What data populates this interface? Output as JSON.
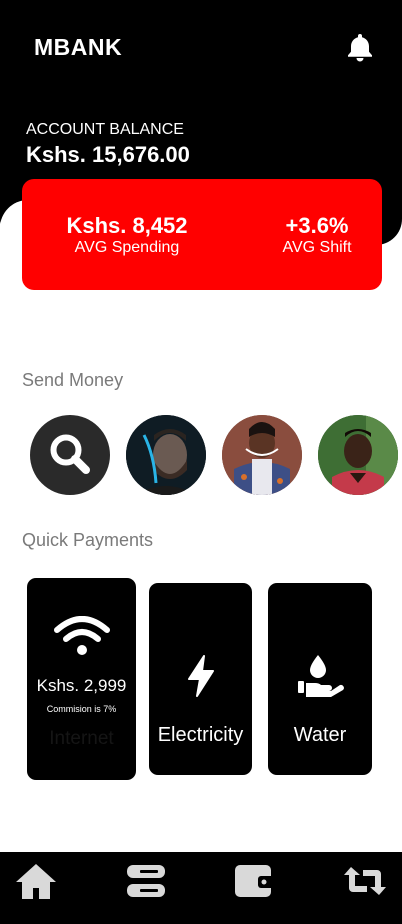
{
  "app": {
    "brand": "MBANK"
  },
  "header": {
    "balance_label": "ACCOUNT BALANCE",
    "balance_value": "Kshs. 15,676.00"
  },
  "stats": {
    "spending_value": "Kshs. 8,452",
    "spending_label": "AVG Spending",
    "shift_value": "+3.6%",
    "shift_label": "AVG Shift"
  },
  "send_money": {
    "title": "Send Money",
    "contacts": [
      {
        "icon": "search-icon"
      },
      {
        "icon": "contact-avatar-1"
      },
      {
        "icon": "contact-avatar-2"
      },
      {
        "icon": "contact-avatar-3"
      }
    ]
  },
  "quick_payments": {
    "title": "Quick Payments",
    "items": [
      {
        "icon": "wifi-icon",
        "amount": "Kshs. 2,999",
        "note": "Commision is 7%",
        "name": "Internet"
      },
      {
        "icon": "lightning-icon",
        "name": "Electricity"
      },
      {
        "icon": "water-hand-icon",
        "name": "Water"
      }
    ]
  },
  "nav": {
    "items": [
      {
        "icon": "home-icon"
      },
      {
        "icon": "cards-icon"
      },
      {
        "icon": "wallet-icon"
      },
      {
        "icon": "transfer-icon"
      }
    ]
  },
  "colors": {
    "accent": "#ff0000",
    "dark": "#000000",
    "muted": "#7a7a7a",
    "nav_icon": "#d9d9d9"
  }
}
